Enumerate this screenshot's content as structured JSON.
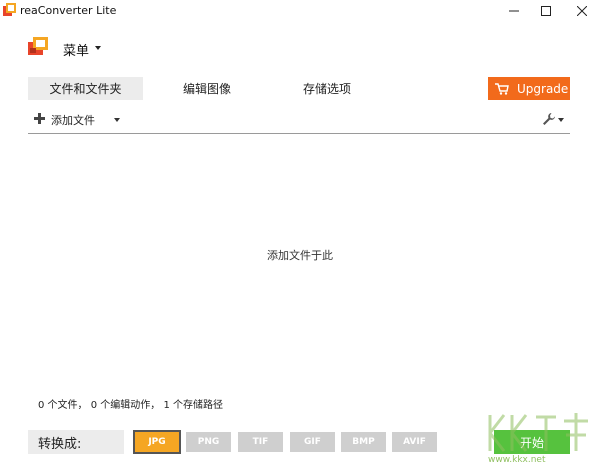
{
  "window": {
    "title": "reaConverter Lite",
    "controls": {
      "minimize": "minimize-icon",
      "maximize": "maximize-icon",
      "close": "close-icon"
    }
  },
  "menu": {
    "label": "菜单"
  },
  "tabs": [
    {
      "label": "文件和文件夹",
      "active": true
    },
    {
      "label": "编辑图像",
      "active": false
    },
    {
      "label": "存储选项",
      "active": false
    }
  ],
  "upgrade": {
    "label": "Upgrade",
    "color": "#f26a1b"
  },
  "toolbar": {
    "add_files_label": "添加文件"
  },
  "dropzone": {
    "hint": "添加文件于此"
  },
  "status": {
    "text": "0 个文件， 0 个编辑动作， 1 个存储路径"
  },
  "bottom": {
    "convert_label": "转换成:",
    "formats": [
      {
        "label": "JPG",
        "selected": true
      },
      {
        "label": "PNG",
        "selected": false
      },
      {
        "label": "TIF",
        "selected": false
      },
      {
        "label": "GIF",
        "selected": false
      },
      {
        "label": "BMP",
        "selected": false
      },
      {
        "label": "AVIF",
        "selected": false
      }
    ],
    "start_label": "开始",
    "start_color": "#56c23e"
  },
  "watermark": {
    "url": "www.kkx.net"
  }
}
